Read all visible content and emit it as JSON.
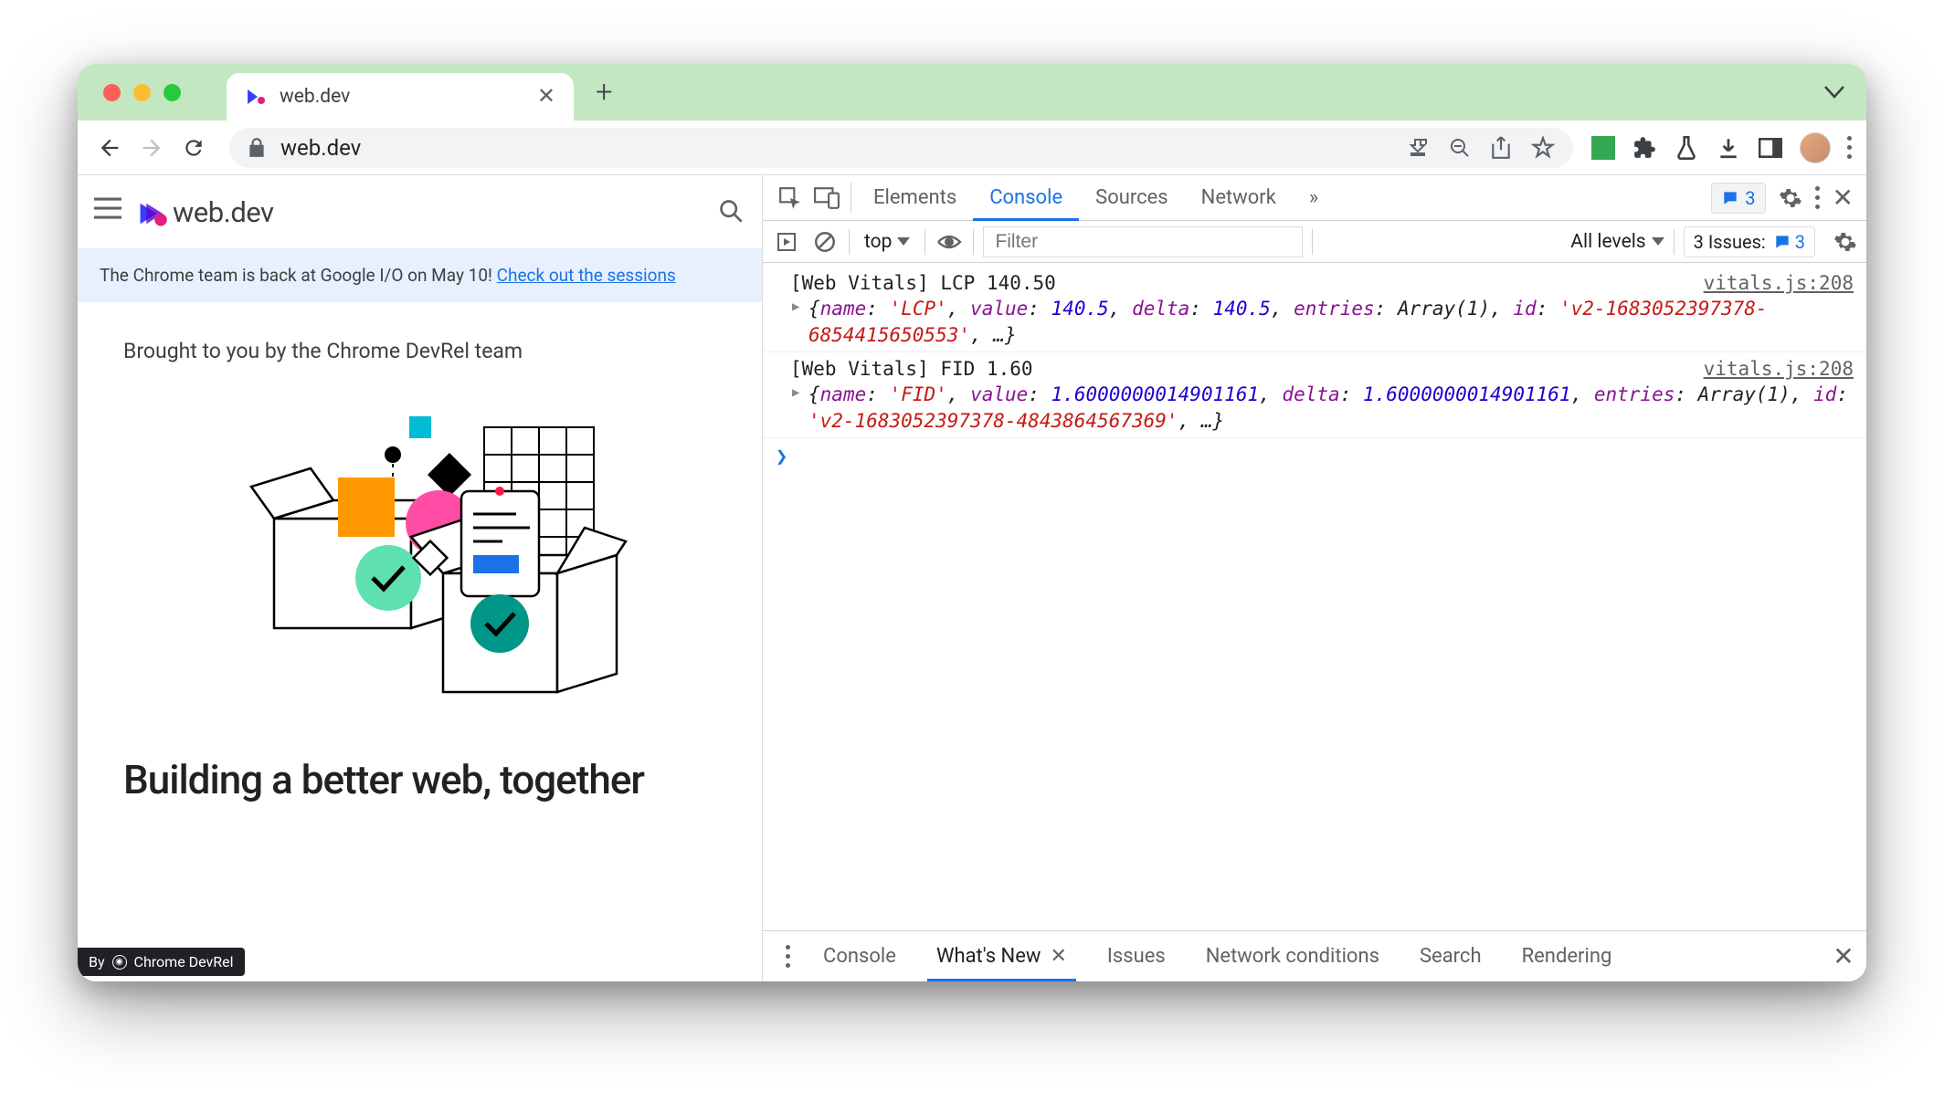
{
  "browser": {
    "tab_title": "web.dev",
    "url": "web.dev"
  },
  "page": {
    "site_name": "web.dev",
    "banner_text": "The Chrome team is back at Google I/O on May 10! ",
    "banner_link": "Check out the sessions",
    "subtitle": "Brought to you by the Chrome DevRel team",
    "headline": "Building a better web, together",
    "attribution_prefix": "By",
    "attribution_name": "Chrome DevRel"
  },
  "devtools": {
    "tabs": [
      "Elements",
      "Console",
      "Sources",
      "Network"
    ],
    "active_tab": "Console",
    "overflow_glyph": "»",
    "messages_badge": "3",
    "console": {
      "context": "top",
      "filter_placeholder": "Filter",
      "levels_label": "All levels",
      "issues_label": "3 Issues:",
      "issues_count": "3"
    },
    "logs": [
      {
        "text": "[Web Vitals] LCP 140.50",
        "source": "vitals.js:208",
        "obj": {
          "name": "LCP",
          "value": "140.5",
          "delta": "140.5",
          "entries": "Array(1)",
          "id": "'v2-1683052397378-6854415650553'"
        }
      },
      {
        "text": "[Web Vitals] FID 1.60",
        "source": "vitals.js:208",
        "obj": {
          "name": "FID",
          "value": "1.6000000014901161",
          "delta": "1.6000000014901161",
          "entries": "Array(1)",
          "id": "'v2-1683052397378-4843864567369'"
        }
      }
    ],
    "drawer": {
      "tabs": [
        "Console",
        "What's New",
        "Issues",
        "Network conditions",
        "Search",
        "Rendering"
      ],
      "active": "What's New"
    }
  }
}
